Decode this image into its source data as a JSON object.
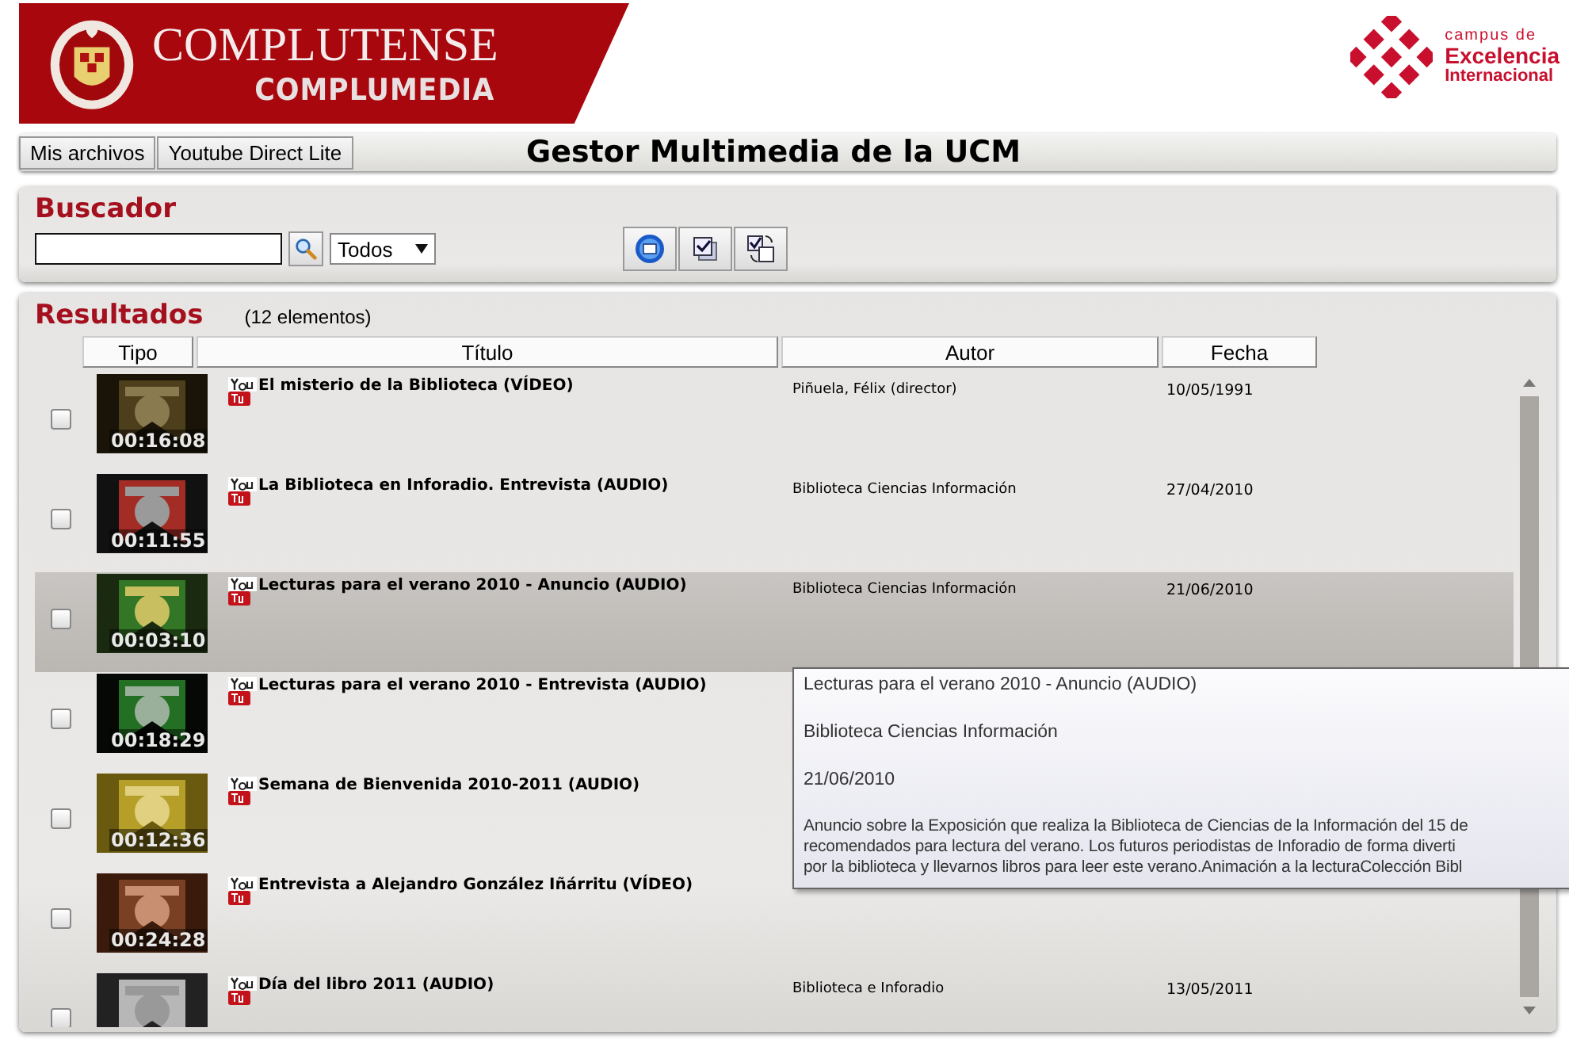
{
  "header": {
    "brand": "COMPLUTENSE",
    "sub_brand": "COMPLUMEDIA",
    "campus": [
      "campus de",
      "Excelencia",
      "Internacional"
    ]
  },
  "nav": {
    "buttons": [
      "Mis archivos",
      "Youtube Direct Lite"
    ],
    "title": "Gestor Multimedia de la UCM"
  },
  "search": {
    "heading": "Buscador",
    "filter": "Todos"
  },
  "results": {
    "heading": "Resultados",
    "count": "(12 elementos)",
    "columns": [
      "Tipo",
      "Título",
      "Autor",
      "Fecha"
    ],
    "rows": [
      {
        "duration": "00:16:08",
        "title": "El misterio de la Biblioteca (VÍDEO)",
        "author": "Piñuela, Félix (director)",
        "date": "10/05/1991",
        "checked": false,
        "selected": false
      },
      {
        "duration": "00:11:55",
        "title": "La Biblioteca en Inforadio. Entrevista (AUDIO)",
        "author": "Biblioteca Ciencias Información",
        "date": "27/04/2010",
        "checked": false,
        "selected": false
      },
      {
        "duration": "00:03:10",
        "title": "Lecturas para el verano 2010 - Anuncio (AUDIO)",
        "author": "Biblioteca Ciencias Información",
        "date": "21/06/2010",
        "checked": false,
        "selected": true
      },
      {
        "duration": "00:18:29",
        "title": "Lecturas para el verano 2010 - Entrevista (AUDIO)",
        "checked": false,
        "selected": false
      },
      {
        "duration": "00:12:36",
        "title": "Semana de Bienvenida 2010-2011 (AUDIO)",
        "checked": false,
        "selected": false
      },
      {
        "duration": "00:24:28",
        "title": "Entrevista a Alejandro González Iñárritu (VÍDEO)",
        "checked": false,
        "selected": false
      },
      {
        "title": "Día del libro 2011 (AUDIO)",
        "author": "Biblioteca e Inforadio",
        "date": "13/05/2011",
        "checked": false,
        "selected": false
      }
    ]
  },
  "tooltip": {
    "lines": [
      "Lecturas para el verano 2010 - Anuncio  (AUDIO)",
      "Biblioteca Ciencias Información",
      "21/06/2010"
    ],
    "description": [
      "Anuncio sobre la Exposición que realiza la Biblioteca de Ciencias de la Información del 15 de",
      "recomendados para lectura del verano. Los futuros periodistas de Inforadio de forma diverti",
      "por la biblioteca y llevarnos libros para leer este verano.Animación a la lecturaColección Bibl"
    ]
  }
}
